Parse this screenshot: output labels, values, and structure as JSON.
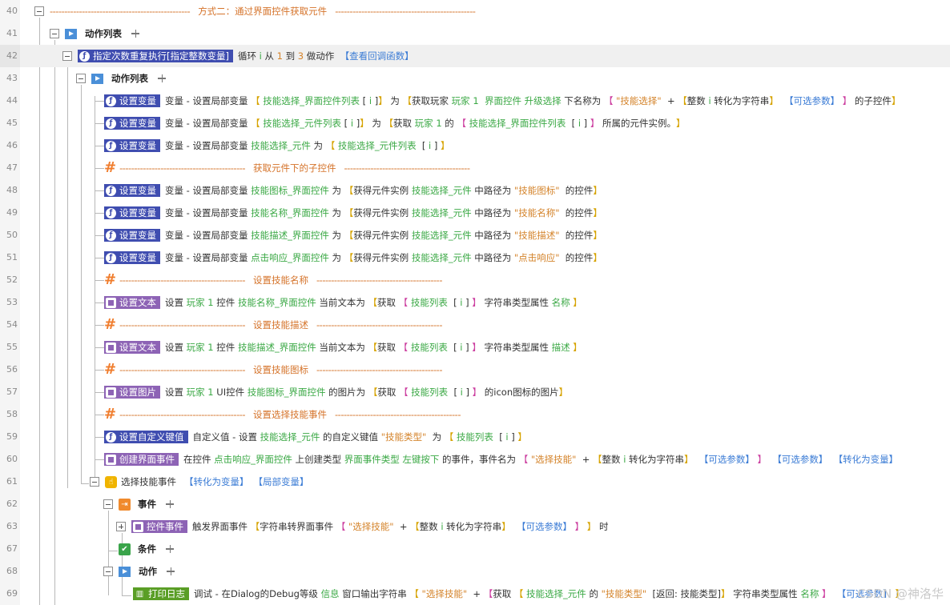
{
  "colors": {
    "keyword": "#333333",
    "variable": "#3aa844",
    "value": "#d4832a",
    "bracket": "#d6a300",
    "link": "#3a7bd5",
    "pink": "#cc3fa0",
    "comment": "#d5732a",
    "tag_blue": "#3f4db0",
    "tag_purple": "#8d63b5",
    "tag_green": "#5a9e26"
  },
  "icons": {
    "variable": "function-icon",
    "text": "square-icon",
    "event_handler": "hand-icon",
    "event": "event-icon",
    "condition": "condition-check-icon",
    "action_list": "play-list-icon",
    "log": "log-icon"
  },
  "watermark": "CSDN @神洛华",
  "rows": [
    {
      "n": "40",
      "indent": 43,
      "collapse": "minus",
      "kind": "comment",
      "dashL": "------------------------------------------------",
      "title": "方式二：通过界面控件获取元件",
      "dashR": "------------------------------------------------"
    },
    {
      "n": "41",
      "indent": 62,
      "collapse": "minus",
      "kind": "list",
      "label": "动作列表"
    },
    {
      "n": "42",
      "indent": 78,
      "collapse": "minus",
      "kind": "action",
      "tag": "指定次数重复执行[指定整数变量]",
      "color": "blue",
      "highlight": true,
      "parts": [
        {
          "t": "循环 ",
          "c": "keyword"
        },
        {
          "t": "i",
          "c": "variable"
        },
        {
          "t": " 从 ",
          "c": "keyword"
        },
        {
          "t": "1",
          "c": "value"
        },
        {
          "t": " 到 ",
          "c": "keyword"
        },
        {
          "t": "3",
          "c": "value"
        },
        {
          "t": " 做动作  ",
          "c": "keyword"
        },
        {
          "t": "【查看回调函数】",
          "c": "link"
        }
      ]
    },
    {
      "n": "43",
      "indent": 95,
      "collapse": "minus",
      "kind": "list",
      "label": "动作列表"
    },
    {
      "n": "44",
      "indent": 130,
      "kind": "action",
      "tag": "设置变量",
      "color": "blue",
      "parts": [
        {
          "t": "变量 - 设置局部变量 ",
          "c": "keyword"
        },
        {
          "t": "【 ",
          "c": "bracket"
        },
        {
          "t": "技能选择_界面控件列表",
          "c": "variable"
        },
        {
          "t": " [ ",
          "c": "keyword"
        },
        {
          "t": "i",
          "c": "variable"
        },
        {
          "t": " ]",
          "c": "keyword"
        },
        {
          "t": "】",
          "c": "bracket"
        },
        {
          "t": " 为 ",
          "c": "keyword"
        },
        {
          "t": "【",
          "c": "bracket"
        },
        {
          "t": "获取玩家 ",
          "c": "keyword"
        },
        {
          "t": "玩家 1",
          "c": "variable"
        },
        {
          "t": "  ",
          "c": "keyword"
        },
        {
          "t": "界面控件 升级选择",
          "c": "variable"
        },
        {
          "t": " 下名称为 ",
          "c": "keyword"
        },
        {
          "t": "【 ",
          "c": "pink"
        },
        {
          "t": "\"技能选择\"",
          "c": "value"
        },
        {
          "t": "  + ",
          "c": "keyword"
        },
        {
          "t": "【",
          "c": "bracket"
        },
        {
          "t": "整数 ",
          "c": "keyword"
        },
        {
          "t": "i",
          "c": "variable"
        },
        {
          "t": " 转化为字符串",
          "c": "keyword"
        },
        {
          "t": "】",
          "c": "bracket"
        },
        {
          "t": "  【可选参数】",
          "c": "link"
        },
        {
          "t": " 】",
          "c": "pink"
        },
        {
          "t": " 的子控件",
          "c": "keyword"
        },
        {
          "t": "】",
          "c": "bracket"
        }
      ]
    },
    {
      "n": "45",
      "indent": 130,
      "kind": "action",
      "tag": "设置变量",
      "color": "blue",
      "parts": [
        {
          "t": "变量 - 设置局部变量 ",
          "c": "keyword"
        },
        {
          "t": "【 ",
          "c": "bracket"
        },
        {
          "t": "技能选择_元件列表",
          "c": "variable"
        },
        {
          "t": " [ ",
          "c": "keyword"
        },
        {
          "t": "i",
          "c": "variable"
        },
        {
          "t": " ]",
          "c": "keyword"
        },
        {
          "t": "】",
          "c": "bracket"
        },
        {
          "t": " 为 ",
          "c": "keyword"
        },
        {
          "t": "【",
          "c": "bracket"
        },
        {
          "t": "获取 ",
          "c": "keyword"
        },
        {
          "t": "玩家 1",
          "c": "variable"
        },
        {
          "t": " 的 ",
          "c": "keyword"
        },
        {
          "t": "【 ",
          "c": "pink"
        },
        {
          "t": "技能选择_界面控件列表",
          "c": "variable"
        },
        {
          "t": "  [ ",
          "c": "keyword"
        },
        {
          "t": "i",
          "c": "variable"
        },
        {
          "t": " ]",
          "c": "keyword"
        },
        {
          "t": " 】",
          "c": "pink"
        },
        {
          "t": " 所属的元件实例。",
          "c": "keyword"
        },
        {
          "t": "】",
          "c": "bracket"
        }
      ]
    },
    {
      "n": "46",
      "indent": 130,
      "kind": "action",
      "tag": "设置变量",
      "color": "blue",
      "parts": [
        {
          "t": "变量 - 设置局部变量 ",
          "c": "keyword"
        },
        {
          "t": "技能选择_元件",
          "c": "variable"
        },
        {
          "t": " 为 ",
          "c": "keyword"
        },
        {
          "t": "【 ",
          "c": "bracket"
        },
        {
          "t": "技能选择_元件列表",
          "c": "variable"
        },
        {
          "t": "  [ ",
          "c": "keyword"
        },
        {
          "t": "i",
          "c": "variable"
        },
        {
          "t": " ]",
          "c": "keyword"
        },
        {
          "t": " 】",
          "c": "bracket"
        }
      ]
    },
    {
      "n": "47",
      "indent": 130,
      "kind": "comment",
      "hash": true,
      "dashL": "-------------------------------------------",
      "title": "获取元件下的子控件",
      "dashR": "-------------------------------------------"
    },
    {
      "n": "48",
      "indent": 130,
      "kind": "action",
      "tag": "设置变量",
      "color": "blue",
      "parts": [
        {
          "t": "变量 - 设置局部变量 ",
          "c": "keyword"
        },
        {
          "t": "技能图标_界面控件",
          "c": "variable"
        },
        {
          "t": " 为 ",
          "c": "keyword"
        },
        {
          "t": "【",
          "c": "bracket"
        },
        {
          "t": "获得元件实例 ",
          "c": "keyword"
        },
        {
          "t": "技能选择_元件",
          "c": "variable"
        },
        {
          "t": " 中路径为 ",
          "c": "keyword"
        },
        {
          "t": "\"技能图标\"",
          "c": "value"
        },
        {
          "t": "  的控件",
          "c": "keyword"
        },
        {
          "t": "】",
          "c": "bracket"
        }
      ]
    },
    {
      "n": "49",
      "indent": 130,
      "kind": "action",
      "tag": "设置变量",
      "color": "blue",
      "parts": [
        {
          "t": "变量 - 设置局部变量 ",
          "c": "keyword"
        },
        {
          "t": "技能名称_界面控件",
          "c": "variable"
        },
        {
          "t": " 为 ",
          "c": "keyword"
        },
        {
          "t": "【",
          "c": "bracket"
        },
        {
          "t": "获得元件实例 ",
          "c": "keyword"
        },
        {
          "t": "技能选择_元件",
          "c": "variable"
        },
        {
          "t": " 中路径为 ",
          "c": "keyword"
        },
        {
          "t": "\"技能名称\"",
          "c": "value"
        },
        {
          "t": "  的控件",
          "c": "keyword"
        },
        {
          "t": "】",
          "c": "bracket"
        }
      ]
    },
    {
      "n": "50",
      "indent": 130,
      "kind": "action",
      "tag": "设置变量",
      "color": "blue",
      "parts": [
        {
          "t": "变量 - 设置局部变量 ",
          "c": "keyword"
        },
        {
          "t": "技能描述_界面控件",
          "c": "variable"
        },
        {
          "t": " 为 ",
          "c": "keyword"
        },
        {
          "t": "【",
          "c": "bracket"
        },
        {
          "t": "获得元件实例 ",
          "c": "keyword"
        },
        {
          "t": "技能选择_元件",
          "c": "variable"
        },
        {
          "t": " 中路径为 ",
          "c": "keyword"
        },
        {
          "t": "\"技能描述\"",
          "c": "value"
        },
        {
          "t": "  的控件",
          "c": "keyword"
        },
        {
          "t": "】",
          "c": "bracket"
        }
      ]
    },
    {
      "n": "51",
      "indent": 130,
      "kind": "action",
      "tag": "设置变量",
      "color": "blue",
      "parts": [
        {
          "t": "变量 - 设置局部变量 ",
          "c": "keyword"
        },
        {
          "t": "点击响应_界面控件",
          "c": "variable"
        },
        {
          "t": " 为 ",
          "c": "keyword"
        },
        {
          "t": "【",
          "c": "bracket"
        },
        {
          "t": "获得元件实例 ",
          "c": "keyword"
        },
        {
          "t": "技能选择_元件",
          "c": "variable"
        },
        {
          "t": " 中路径为 ",
          "c": "keyword"
        },
        {
          "t": "\"点击响应\"",
          "c": "value"
        },
        {
          "t": "  的控件",
          "c": "keyword"
        },
        {
          "t": "】",
          "c": "bracket"
        }
      ]
    },
    {
      "n": "52",
      "indent": 130,
      "kind": "comment",
      "hash": true,
      "dashL": "-------------------------------------------",
      "title": "设置技能名称",
      "dashR": "-------------------------------------------"
    },
    {
      "n": "53",
      "indent": 130,
      "kind": "action",
      "tag": "设置文本",
      "color": "purple",
      "parts": [
        {
          "t": "设置 ",
          "c": "keyword"
        },
        {
          "t": "玩家 1",
          "c": "variable"
        },
        {
          "t": " 控件 ",
          "c": "keyword"
        },
        {
          "t": "技能名称_界面控件",
          "c": "variable"
        },
        {
          "t": " 当前文本为 ",
          "c": "keyword"
        },
        {
          "t": "【",
          "c": "bracket"
        },
        {
          "t": "获取 ",
          "c": "keyword"
        },
        {
          "t": "【 ",
          "c": "pink"
        },
        {
          "t": "技能列表",
          "c": "variable"
        },
        {
          "t": "  [ ",
          "c": "keyword"
        },
        {
          "t": "i",
          "c": "variable"
        },
        {
          "t": " ]",
          "c": "keyword"
        },
        {
          "t": " 】",
          "c": "pink"
        },
        {
          "t": " 字符串类型属性 ",
          "c": "keyword"
        },
        {
          "t": "名称",
          "c": "variable"
        },
        {
          "t": " 】",
          "c": "bracket"
        }
      ]
    },
    {
      "n": "54",
      "indent": 130,
      "kind": "comment",
      "hash": true,
      "dashL": "-------------------------------------------",
      "title": "设置技能描述",
      "dashR": "-------------------------------------------"
    },
    {
      "n": "55",
      "indent": 130,
      "kind": "action",
      "tag": "设置文本",
      "color": "purple",
      "parts": [
        {
          "t": "设置 ",
          "c": "keyword"
        },
        {
          "t": "玩家 1",
          "c": "variable"
        },
        {
          "t": " 控件 ",
          "c": "keyword"
        },
        {
          "t": "技能描述_界面控件",
          "c": "variable"
        },
        {
          "t": " 当前文本为 ",
          "c": "keyword"
        },
        {
          "t": "【",
          "c": "bracket"
        },
        {
          "t": "获取 ",
          "c": "keyword"
        },
        {
          "t": "【 ",
          "c": "pink"
        },
        {
          "t": "技能列表",
          "c": "variable"
        },
        {
          "t": "  [ ",
          "c": "keyword"
        },
        {
          "t": "i",
          "c": "variable"
        },
        {
          "t": " ]",
          "c": "keyword"
        },
        {
          "t": " 】",
          "c": "pink"
        },
        {
          "t": " 字符串类型属性 ",
          "c": "keyword"
        },
        {
          "t": "描述",
          "c": "variable"
        },
        {
          "t": " 】",
          "c": "bracket"
        }
      ]
    },
    {
      "n": "56",
      "indent": 130,
      "kind": "comment",
      "hash": true,
      "dashL": "-------------------------------------------",
      "title": "设置技能图标",
      "dashR": "-------------------------------------------"
    },
    {
      "n": "57",
      "indent": 130,
      "kind": "action",
      "tag": "设置图片",
      "color": "purple",
      "parts": [
        {
          "t": "设置 ",
          "c": "keyword"
        },
        {
          "t": "玩家 1",
          "c": "variable"
        },
        {
          "t": " UI控件 ",
          "c": "keyword"
        },
        {
          "t": "技能图标_界面控件",
          "c": "variable"
        },
        {
          "t": " 的图片为 ",
          "c": "keyword"
        },
        {
          "t": "【",
          "c": "bracket"
        },
        {
          "t": "获取 ",
          "c": "keyword"
        },
        {
          "t": "【 ",
          "c": "pink"
        },
        {
          "t": "技能列表",
          "c": "variable"
        },
        {
          "t": "  [ ",
          "c": "keyword"
        },
        {
          "t": "i",
          "c": "variable"
        },
        {
          "t": " ]",
          "c": "keyword"
        },
        {
          "t": " 】",
          "c": "pink"
        },
        {
          "t": " 的icon图标的图片",
          "c": "keyword"
        },
        {
          "t": "】",
          "c": "bracket"
        }
      ]
    },
    {
      "n": "58",
      "indent": 130,
      "kind": "comment",
      "hash": true,
      "dashL": "-------------------------------------------",
      "title": "设置选择技能事件",
      "dashR": "-------------------------------------------"
    },
    {
      "n": "59",
      "indent": 130,
      "kind": "action",
      "tag": "设置自定义键值",
      "color": "blue",
      "parts": [
        {
          "t": "自定义值 - 设置 ",
          "c": "keyword"
        },
        {
          "t": "技能选择_元件",
          "c": "variable"
        },
        {
          "t": " 的自定义键值 ",
          "c": "keyword"
        },
        {
          "t": "\"技能类型\"",
          "c": "value"
        },
        {
          "t": "  为 ",
          "c": "keyword"
        },
        {
          "t": "【 ",
          "c": "bracket"
        },
        {
          "t": "技能列表",
          "c": "variable"
        },
        {
          "t": "  [ ",
          "c": "keyword"
        },
        {
          "t": "i",
          "c": "variable"
        },
        {
          "t": " ]",
          "c": "keyword"
        },
        {
          "t": " 】",
          "c": "bracket"
        }
      ]
    },
    {
      "n": "60",
      "indent": 130,
      "kind": "action",
      "tag": "创建界面事件",
      "color": "purple",
      "parts": [
        {
          "t": "在控件 ",
          "c": "keyword"
        },
        {
          "t": "点击响应_界面控件",
          "c": "variable"
        },
        {
          "t": " 上创建类型 ",
          "c": "keyword"
        },
        {
          "t": "界面事件类型 左键按下",
          "c": "variable"
        },
        {
          "t": " 的事件，事件名为 ",
          "c": "keyword"
        },
        {
          "t": "【 ",
          "c": "pink"
        },
        {
          "t": "\"选择技能\"",
          "c": "value"
        },
        {
          "t": "  + ",
          "c": "keyword"
        },
        {
          "t": "【",
          "c": "bracket"
        },
        {
          "t": "整数 ",
          "c": "keyword"
        },
        {
          "t": "i",
          "c": "variable"
        },
        {
          "t": " 转化为字符串",
          "c": "keyword"
        },
        {
          "t": "】",
          "c": "bracket"
        },
        {
          "t": "  【可选参数】",
          "c": "link"
        },
        {
          "t": " 】",
          "c": "pink"
        },
        {
          "t": "  【可选参数】",
          "c": "link"
        },
        {
          "t": "  【转化为变量】",
          "c": "link"
        }
      ]
    },
    {
      "n": "61",
      "indent": 112,
      "collapse": "minus",
      "kind": "handler",
      "label": "选择技能事件",
      "links": [
        "【转化为变量】",
        "【局部变量】"
      ]
    },
    {
      "n": "62",
      "indent": 129,
      "collapse": "minus",
      "kind": "event",
      "label": "事件"
    },
    {
      "n": "63",
      "indent": 145,
      "collapse": "plus",
      "kind": "action",
      "tag": "控件事件",
      "color": "purple",
      "parts": [
        {
          "t": "触发界面事件 ",
          "c": "keyword"
        },
        {
          "t": "【",
          "c": "bracket"
        },
        {
          "t": "字符串转界面事件 ",
          "c": "keyword"
        },
        {
          "t": "【 ",
          "c": "pink"
        },
        {
          "t": "\"选择技能\"",
          "c": "value"
        },
        {
          "t": "  + ",
          "c": "keyword"
        },
        {
          "t": "【",
          "c": "bracket"
        },
        {
          "t": "整数 ",
          "c": "keyword"
        },
        {
          "t": "i",
          "c": "variable"
        },
        {
          "t": " 转化为字符串",
          "c": "keyword"
        },
        {
          "t": "】",
          "c": "bracket"
        },
        {
          "t": "  【可选参数】",
          "c": "link"
        },
        {
          "t": " 】",
          "c": "pink"
        },
        {
          "t": " 】",
          "c": "bracket"
        },
        {
          "t": " 时",
          "c": "keyword"
        }
      ]
    },
    {
      "n": "67",
      "indent": 148,
      "kind": "condition",
      "label": "条件"
    },
    {
      "n": "68",
      "indent": 129,
      "collapse": "minus",
      "kind": "list",
      "label": "动作"
    },
    {
      "n": "69",
      "indent": 166,
      "kind": "action",
      "tag": "打印日志",
      "color": "green",
      "parts": [
        {
          "t": "调试 - 在Dialog的Debug等级 ",
          "c": "keyword"
        },
        {
          "t": "信息",
          "c": "variable"
        },
        {
          "t": " 窗口输出字符串 ",
          "c": "keyword"
        },
        {
          "t": "【 ",
          "c": "bracket"
        },
        {
          "t": "\"选择技能\"",
          "c": "value"
        },
        {
          "t": "  + ",
          "c": "keyword"
        },
        {
          "t": "【",
          "c": "pink"
        },
        {
          "t": "获取 ",
          "c": "keyword"
        },
        {
          "t": "【 ",
          "c": "bracket"
        },
        {
          "t": "技能选择_元件",
          "c": "variable"
        },
        {
          "t": " 的 ",
          "c": "keyword"
        },
        {
          "t": "\"技能类型\"",
          "c": "value"
        },
        {
          "t": "  [返回: 技能类型]",
          "c": "keyword"
        },
        {
          "t": "】",
          "c": "bracket"
        },
        {
          "t": " 字符串类型属性 ",
          "c": "keyword"
        },
        {
          "t": "名称",
          "c": "variable"
        },
        {
          "t": " 】",
          "c": "pink"
        },
        {
          "t": "  【可选参数】",
          "c": "link"
        },
        {
          "t": " 】",
          "c": "bracket"
        }
      ]
    }
  ]
}
